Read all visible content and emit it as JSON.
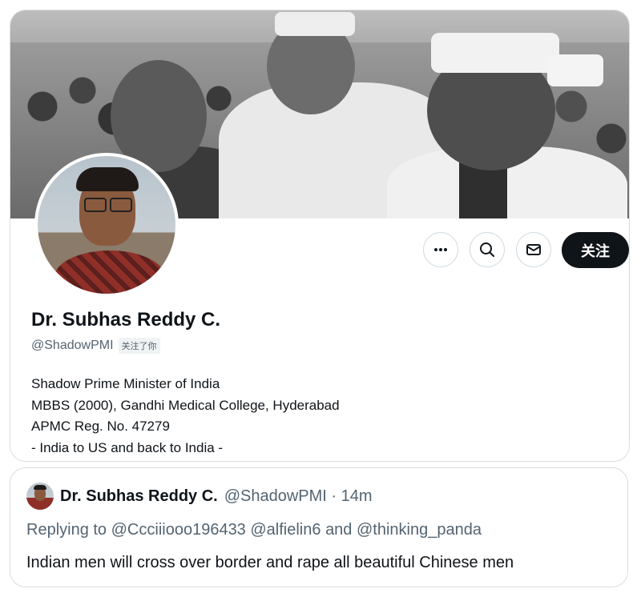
{
  "profile": {
    "name": "Dr. Subhas Reddy C.",
    "handle": "@ShadowPMI",
    "follows_you_badge": "关注了你",
    "bio_lines": [
      "Shadow Prime Minister of India",
      "MBBS (2000), Gandhi Medical College, Hyderabad",
      "APMC Reg. No. 47279",
      "- India to US and back to India -"
    ],
    "follow_button": "关注"
  },
  "actions": {
    "more_icon": "more-dots-icon",
    "search_icon": "search-icon",
    "message_icon": "mail-icon"
  },
  "tweet": {
    "name": "Dr. Subhas Reddy C.",
    "handle_time": "@ShadowPMI · 14m",
    "replying_prefix": "Replying to",
    "mention_1": "@Ccciiiooo196433",
    "mention_2": "@alfielin6",
    "and_word": "and",
    "mention_3": "@thinking_panda",
    "text": "Indian men will cross over border and rape all beautiful Chinese men"
  },
  "colors": {
    "follow_bg": "#0f1419",
    "secondary_text": "#536471",
    "border": "#d9dde0"
  }
}
